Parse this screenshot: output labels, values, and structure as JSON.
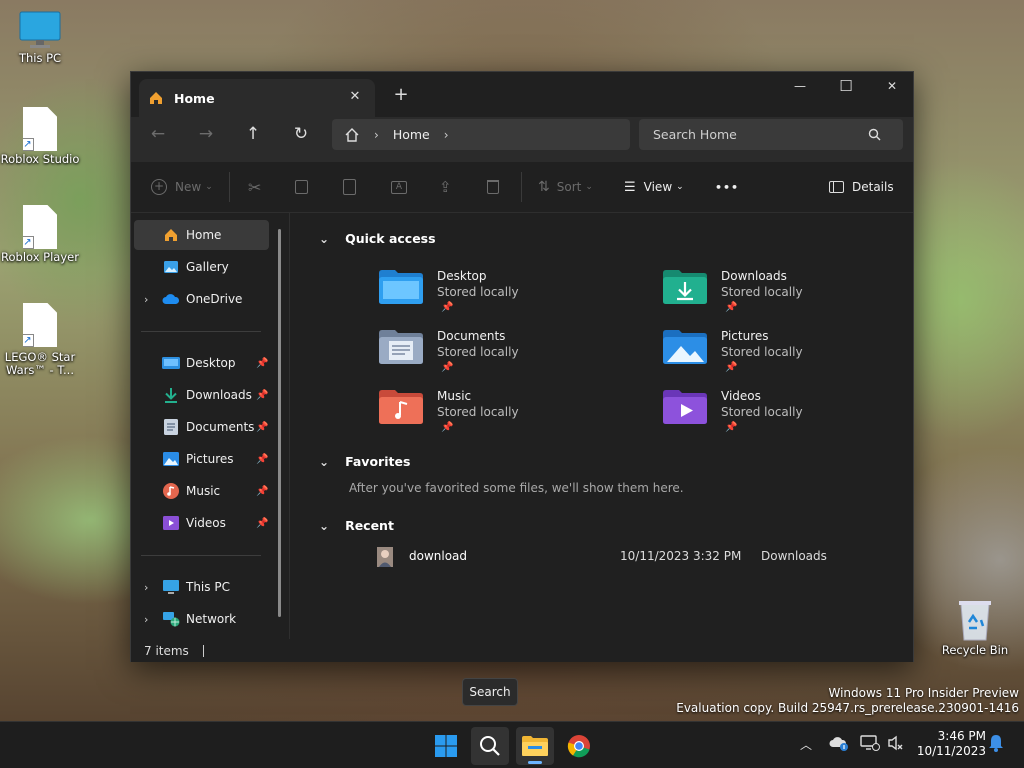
{
  "desktop": {
    "icons": [
      {
        "label": "This PC",
        "icon": "monitor-icon"
      },
      {
        "label": "Roblox Studio",
        "icon": "shortcut-file-icon"
      },
      {
        "label": "Roblox Player",
        "icon": "shortcut-file-icon"
      },
      {
        "label": "LEGO® Star Wars™ - T...",
        "label_line1": "LEGO® Star",
        "label_line2": "Wars™ - T...",
        "icon": "shortcut-file-icon"
      },
      {
        "label": "Recycle Bin",
        "icon": "recycle-bin-icon"
      }
    ]
  },
  "explorer": {
    "tab": {
      "title": "Home",
      "close_icon": "close-icon"
    },
    "new_tab_symbol": "+",
    "window_controls": {
      "minimize": "—",
      "maximize": "☐",
      "close": "✕"
    },
    "nav": {
      "back": "←",
      "forward": "→",
      "up": "↑",
      "refresh": "↻"
    },
    "address": {
      "segments": [
        "Home"
      ],
      "separator": "›"
    },
    "search": {
      "placeholder": "Search Home"
    },
    "toolbar": {
      "new_label": "New",
      "sort_label": "Sort",
      "view_label": "View",
      "more_symbol": "•••",
      "details_label": "Details"
    },
    "sidebar": {
      "items": [
        {
          "label": "Home",
          "icon": "home-icon",
          "selected": true
        },
        {
          "label": "Gallery",
          "icon": "gallery-icon"
        },
        {
          "label": "OneDrive",
          "icon": "cloud-icon",
          "expandable": true
        },
        {
          "label": "Desktop",
          "icon": "desktop-folder-icon",
          "pinned": true
        },
        {
          "label": "Downloads",
          "icon": "download-icon",
          "pinned": true
        },
        {
          "label": "Documents",
          "icon": "documents-icon",
          "pinned": true
        },
        {
          "label": "Pictures",
          "icon": "pictures-icon",
          "pinned": true
        },
        {
          "label": "Music",
          "icon": "music-icon",
          "pinned": true
        },
        {
          "label": "Videos",
          "icon": "videos-icon",
          "pinned": true
        },
        {
          "label": "This PC",
          "icon": "monitor-icon",
          "expandable": true
        },
        {
          "label": "Network",
          "icon": "network-icon",
          "expandable": true
        }
      ],
      "chevron": "›",
      "pin_symbol": "📌"
    },
    "quick_access": {
      "heading": "Quick access",
      "items": [
        {
          "name": "Desktop",
          "status": "Stored locally",
          "color": "#2f8fe0"
        },
        {
          "name": "Downloads",
          "status": "Stored locally",
          "color": "#21a889"
        },
        {
          "name": "Documents",
          "status": "Stored locally",
          "color": "#8a9bb4"
        },
        {
          "name": "Pictures",
          "status": "Stored locally",
          "color": "#2c8ee6"
        },
        {
          "name": "Music",
          "status": "Stored locally",
          "color": "#e8664e"
        },
        {
          "name": "Videos",
          "status": "Stored locally",
          "color": "#8a4fd6"
        }
      ]
    },
    "favorites": {
      "heading": "Favorites",
      "empty_message": "After you've favorited some files, we'll show them here."
    },
    "recent": {
      "heading": "Recent",
      "files": [
        {
          "name": "download",
          "date": "10/11/2023 3:32 PM",
          "location": "Downloads"
        }
      ]
    },
    "status": {
      "item_count": "7 items"
    }
  },
  "tooltip": {
    "text": "Search"
  },
  "watermark": {
    "line1": "Windows 11 Pro Insider Preview",
    "line2": "Evaluation copy. Build 25947.rs_prerelease.230901-1416"
  },
  "taskbar": {
    "apps": [
      "start-icon",
      "search-icon",
      "file-explorer-icon",
      "chrome-icon"
    ],
    "tray": {
      "chevron": "^"
    },
    "clock": {
      "time": "3:46 PM",
      "date": "10/11/2023"
    }
  }
}
